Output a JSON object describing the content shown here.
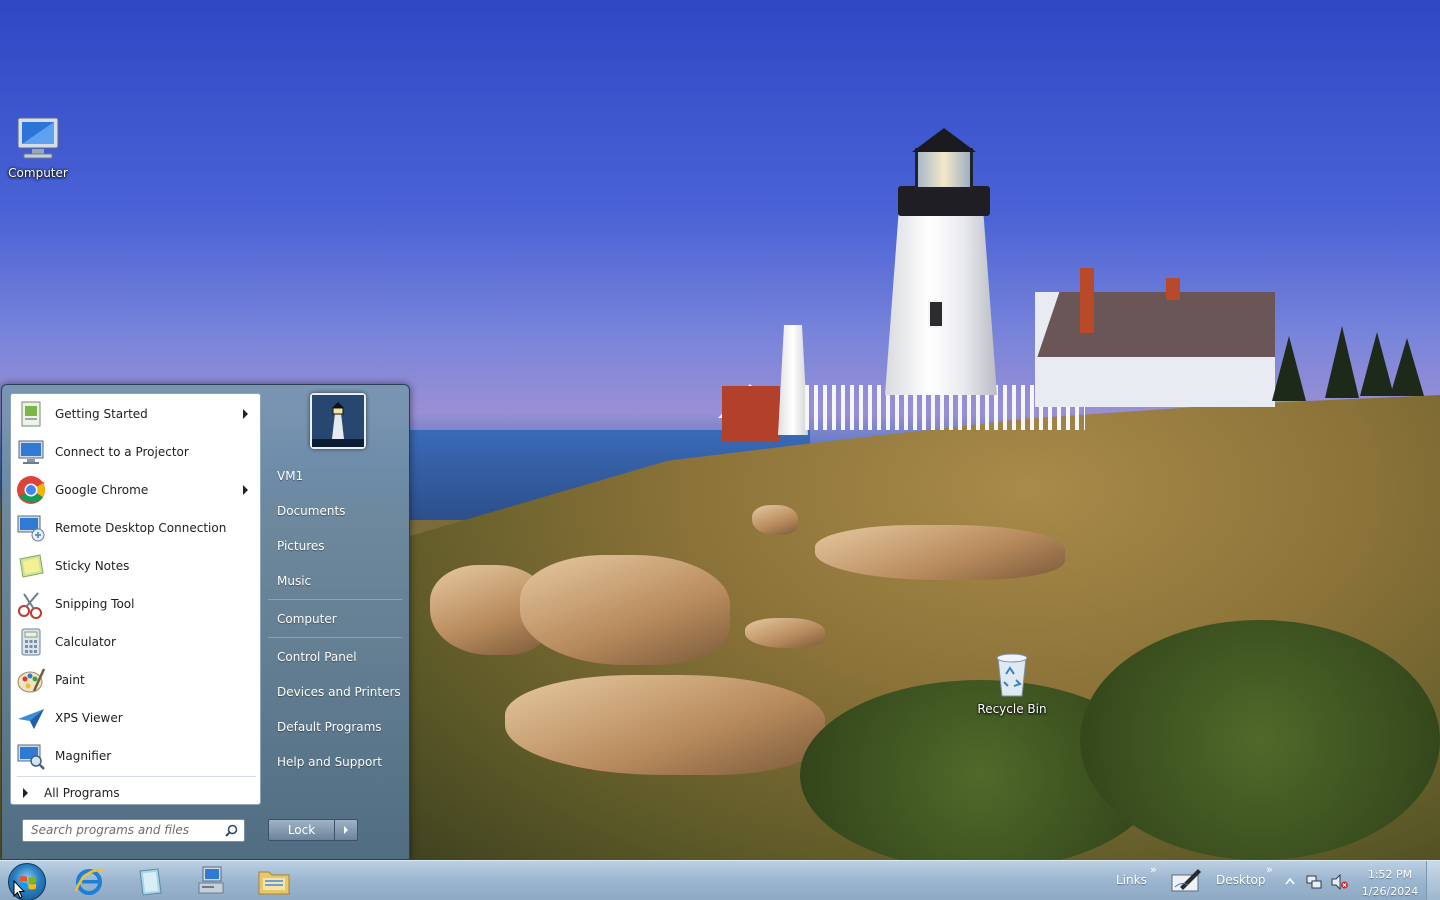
{
  "desktop": {
    "icons": [
      {
        "label": "Computer",
        "icon": "computer-icon"
      },
      {
        "label": "Recycle Bin",
        "icon": "recycle-bin-icon"
      }
    ]
  },
  "start_menu": {
    "programs": [
      {
        "label": "Getting Started",
        "icon": "getting-started-icon",
        "submenu": true
      },
      {
        "label": "Connect to a Projector",
        "icon": "projector-icon",
        "submenu": false
      },
      {
        "label": "Google Chrome",
        "icon": "chrome-icon",
        "submenu": true
      },
      {
        "label": "Remote Desktop Connection",
        "icon": "remote-desktop-icon",
        "submenu": false
      },
      {
        "label": "Sticky Notes",
        "icon": "sticky-notes-icon",
        "submenu": false
      },
      {
        "label": "Snipping Tool",
        "icon": "snipping-tool-icon",
        "submenu": false
      },
      {
        "label": "Calculator",
        "icon": "calculator-icon",
        "submenu": false
      },
      {
        "label": "Paint",
        "icon": "paint-icon",
        "submenu": false
      },
      {
        "label": "XPS Viewer",
        "icon": "xps-viewer-icon",
        "submenu": false
      },
      {
        "label": "Magnifier",
        "icon": "magnifier-icon",
        "submenu": false
      }
    ],
    "all_programs": "All Programs",
    "search_placeholder": "Search programs and files",
    "user_name": "VM1",
    "right_items": [
      {
        "label": "Documents"
      },
      {
        "label": "Pictures"
      },
      {
        "label": "Music"
      },
      {
        "label": "Computer"
      },
      {
        "label": "Control Panel"
      },
      {
        "label": "Devices and Printers"
      },
      {
        "label": "Default Programs"
      },
      {
        "label": "Help and Support"
      }
    ],
    "shutdown_label": "Lock"
  },
  "taskbar": {
    "pinned": [
      {
        "icon": "internet-explorer-icon"
      },
      {
        "icon": "notepad-icon"
      },
      {
        "icon": "network-computer-icon"
      },
      {
        "icon": "windows-explorer-icon"
      }
    ],
    "toolbars": {
      "links_label": "Links",
      "desktop_label": "Desktop"
    },
    "tray": {
      "time": "1:52 PM",
      "date": "1/26/2024"
    }
  },
  "colors": {
    "taskbar": "#9bb6cf",
    "start_menu_frame": "#6f8aa3",
    "accent": "#2a7ec0"
  }
}
